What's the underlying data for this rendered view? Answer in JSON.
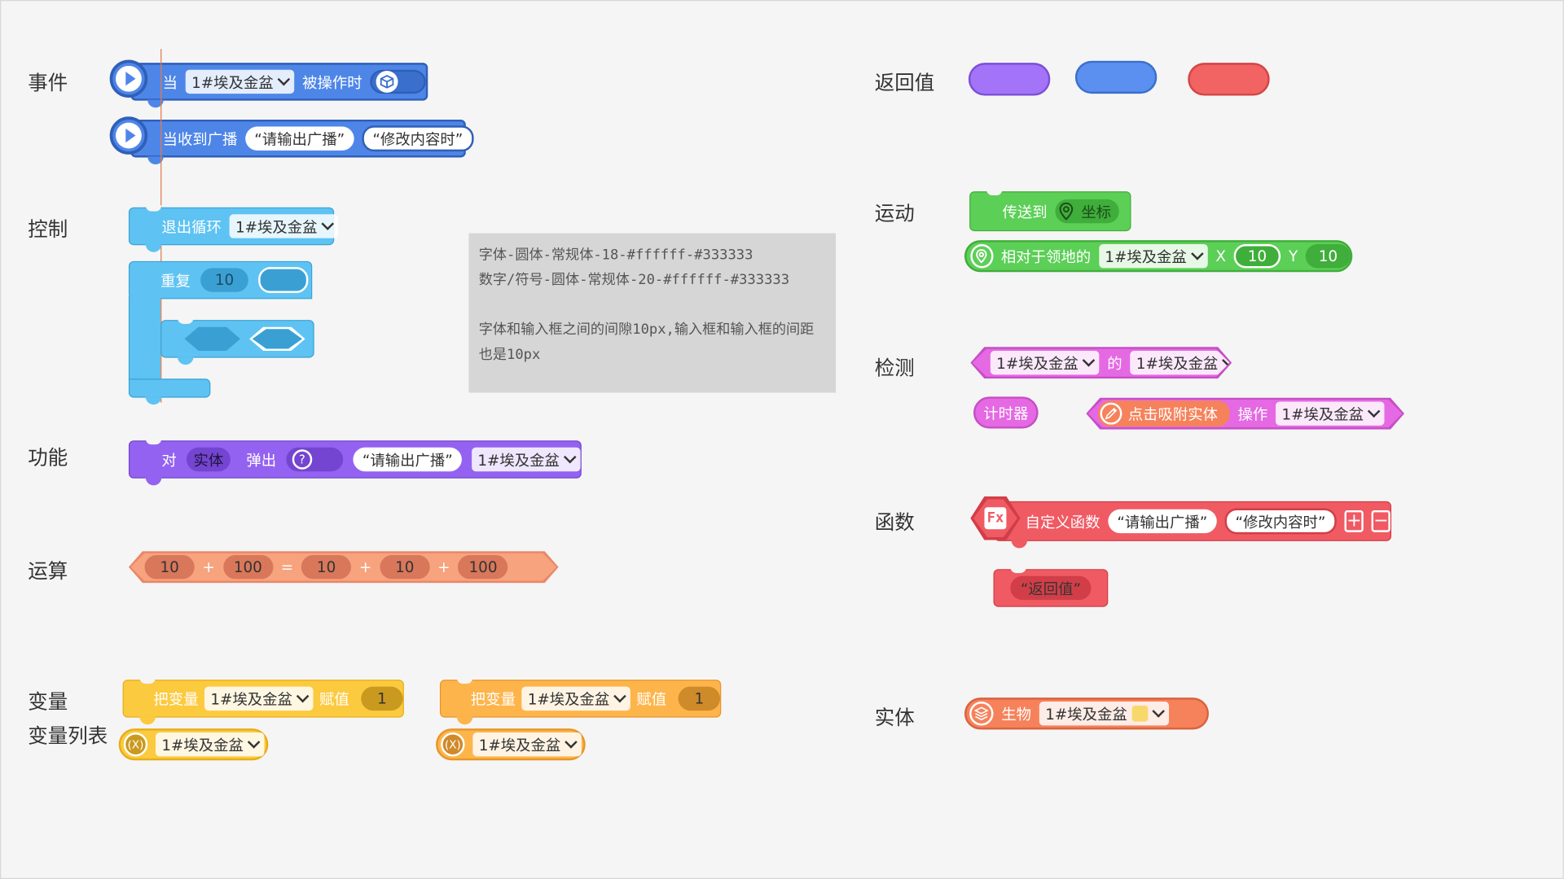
{
  "labels": {
    "event": "事件",
    "control": "控制",
    "function": "功能",
    "operation": "运算",
    "variable": "变量",
    "variable_list": "变量列表",
    "return_value": "返回值",
    "motion": "运动",
    "detect": "检测",
    "func": "函数",
    "entity": "实体"
  },
  "entity_option": "1#埃及金盆",
  "event_blocks": {
    "when": "当",
    "operated": "被操作时",
    "when_receive": "当收到广播",
    "broadcast_str": "“请输出广播”",
    "modify_str": "“修改内容时”"
  },
  "control_blocks": {
    "exit_loop": "退出循环",
    "repeat": "重复",
    "repeat_count": "10"
  },
  "note": {
    "line1": "字体-圆体-常规体-18-#ffffff-#333333",
    "line2": "数字/符号-圆体-常规体-20-#ffffff-#333333",
    "line3": "字体和输入框之间的间隙10px,输入框和输入框的间距",
    "line4": "也是10px"
  },
  "function_block": {
    "to": "对",
    "entity": "实体",
    "popup": "弹出",
    "question": "?",
    "broadcast_str": "“请输出广播”"
  },
  "operation_block": {
    "a": "10",
    "plus1": "+",
    "b": "100",
    "eq": "=",
    "c": "10",
    "plus2": "+",
    "d": "10",
    "plus3": "+",
    "e": "100"
  },
  "variable_blocks": {
    "set_var": "把变量",
    "assign": "赋值",
    "value": "1",
    "var_icon": "(X)"
  },
  "motion_blocks": {
    "teleport": "传送到",
    "coord": "坐标",
    "relative": "相对于领地的",
    "x_label": "X",
    "x_val": "10",
    "y_label": "Y",
    "y_val": "10"
  },
  "detect_blocks": {
    "of": "的",
    "timer": "计时器",
    "click_attach": "点击吸附实体",
    "operate": "操作"
  },
  "func_blocks": {
    "custom_func": "自定义函数",
    "broadcast_str": "“请输出广播”",
    "modify_str": "“修改内容时”",
    "plus": "+",
    "minus": "−",
    "return_str": "“返回值”"
  },
  "entity_block": {
    "creature": "生物"
  },
  "colors": {
    "event_blue": "#4e86e8",
    "control_cyan": "#5ec3f2",
    "function_purple": "#9462f0",
    "operation_orange": "#f7a37e",
    "variable_yellow": "#fcca3f",
    "variable_orange": "#fdb54b",
    "return_purple": "#a374f7",
    "return_blue": "#5b8ff0",
    "return_red": "#f26464",
    "motion_green": "#5ccf57",
    "detect_pink": "#e469e3",
    "func_red": "#f05a63",
    "entity_orange": "#f6825b"
  }
}
